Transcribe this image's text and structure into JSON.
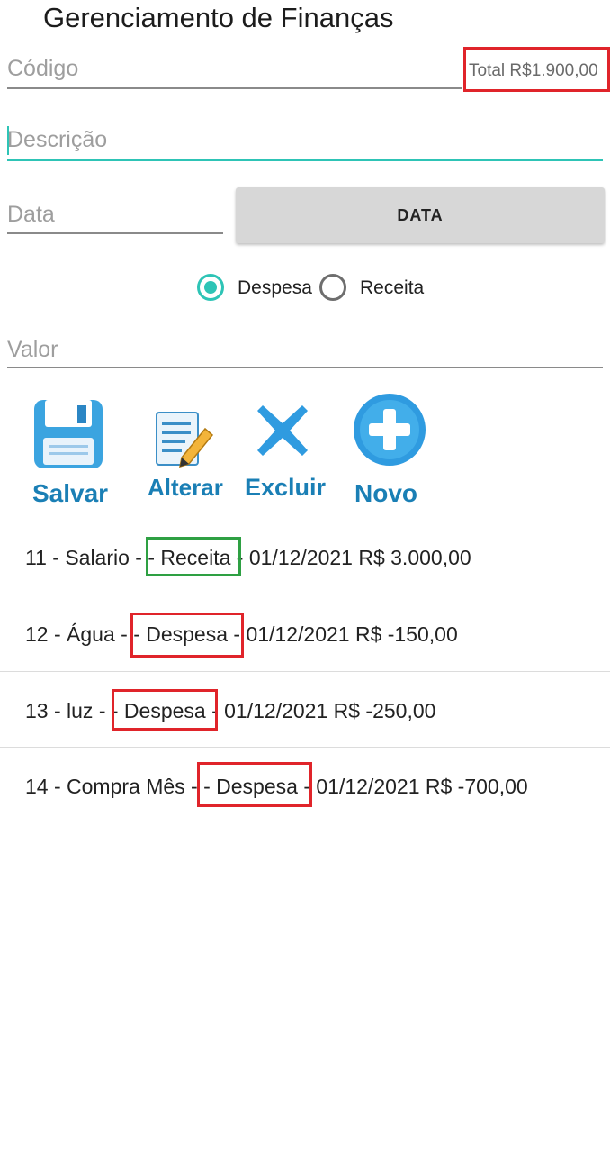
{
  "app": {
    "title": "Gerenciamento de Finanças"
  },
  "form": {
    "codigo_placeholder": "Código",
    "total_label": "Total R$1.900,00",
    "descricao_placeholder": "Descrição",
    "data_placeholder": "Data",
    "data_button": "DATA",
    "tipo": {
      "options": [
        "Despesa",
        "Receita"
      ],
      "selected": "Despesa"
    },
    "valor_placeholder": "Valor"
  },
  "actions": {
    "salvar": "Salvar",
    "alterar": "Alterar",
    "excluir": "Excluir",
    "novo": "Novo"
  },
  "transactions": [
    {
      "prefix": "11 - Salario -",
      "tipo": "- Receita",
      "suffix": "- 01/12/2021 R$ 3.000,00"
    },
    {
      "prefix": "12 - Água -",
      "tipo": "- Despesa",
      "suffix": "- 01/12/2021 R$ -150,00"
    },
    {
      "prefix": "13 - luz -",
      "tipo": "- Despesa",
      "suffix": "- 01/12/2021 R$ -250,00"
    },
    {
      "prefix": "14 - Compra Mês -",
      "tipo": "- Despesa",
      "suffix": "- 01/12/2021 R$ -700,00"
    }
  ],
  "colors": {
    "accent": "#2ec4b6",
    "highlight_red": "#e0242a",
    "highlight_green": "#2ea043",
    "icon_blue": "#1a7fb5"
  },
  "icons": [
    "floppy-disk-icon",
    "edit-document-icon",
    "delete-x-icon",
    "add-plus-icon"
  ]
}
